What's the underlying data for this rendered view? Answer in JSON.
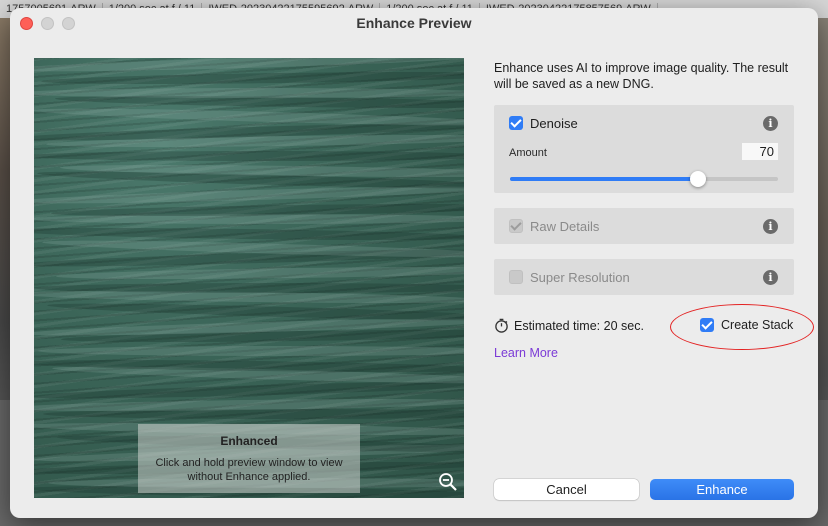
{
  "background": {
    "files": [
      "1757005691.ARW",
      "1/200 sec at f / 11",
      "IWED-20230422175595692.ARW",
      "1/200 sec at f / 11",
      "IWED-20230422175857569.ARW"
    ]
  },
  "dialog": {
    "title": "Enhance Preview"
  },
  "preview": {
    "overlay_title": "Enhanced",
    "overlay_text_line1": "Click and hold preview window to view",
    "overlay_text_line2": "without Enhance applied."
  },
  "panel": {
    "description": "Enhance uses AI to improve image quality. The result will be saved as a new DNG.",
    "denoise": {
      "label": "Denoise",
      "checked": true,
      "amount_label": "Amount",
      "amount_value": "70",
      "amount_fraction": 0.7
    },
    "raw_details": {
      "label": "Raw Details",
      "checked": true,
      "enabled": false
    },
    "super_resolution": {
      "label": "Super Resolution",
      "checked": false,
      "enabled": false
    },
    "estimated_time": "Estimated time: 20 sec.",
    "create_stack": {
      "label": "Create Stack",
      "checked": true
    },
    "learn_more": "Learn More"
  },
  "buttons": {
    "cancel": "Cancel",
    "enhance": "Enhance"
  },
  "colors": {
    "accent": "#2f7cf6",
    "link": "#7b3ad6",
    "annotation": "#e32222"
  }
}
